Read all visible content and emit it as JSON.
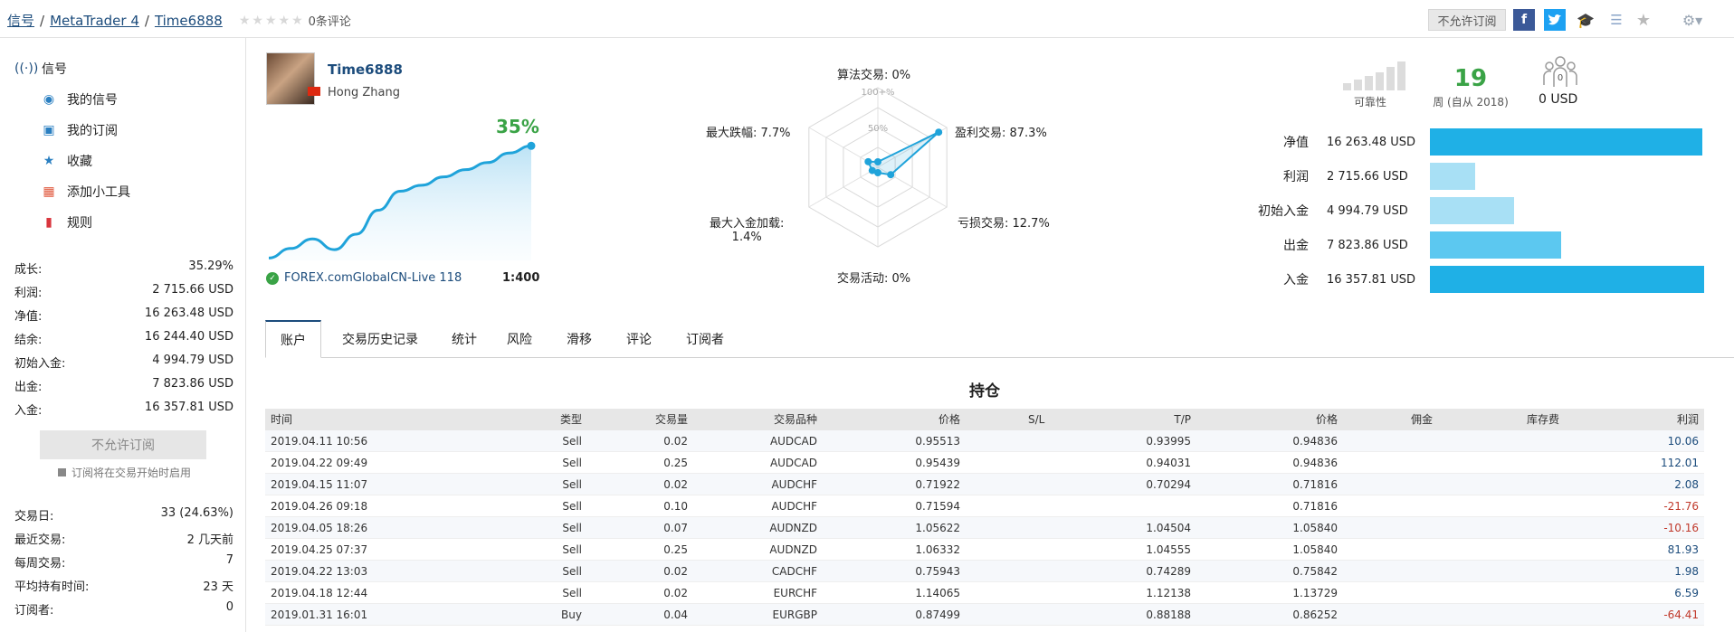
{
  "breadcrumb": {
    "root": "信号",
    "platform": "MetaTrader 4",
    "signal": "Time6888"
  },
  "rating": {
    "stars": 0,
    "reviews": "0条评论"
  },
  "top_actions": {
    "subscribe_disabled": "不允许订阅"
  },
  "sidebar": {
    "nav": [
      {
        "label": "信号",
        "icon": "antenna-icon"
      },
      {
        "label": "我的信号",
        "icon": "user-signal-icon"
      },
      {
        "label": "我的订阅",
        "icon": "subscription-icon"
      },
      {
        "label": "收藏",
        "icon": "star-icon"
      },
      {
        "label": "添加小工具",
        "icon": "widget-icon"
      },
      {
        "label": "规则",
        "icon": "bookmark-icon"
      }
    ],
    "stats": [
      {
        "label": "成长:",
        "value": "35.29%"
      },
      {
        "label": "利润:",
        "value": "2 715.66 USD"
      },
      {
        "label": "净值:",
        "value": "16 263.48 USD"
      },
      {
        "label": "结余:",
        "value": "16 244.40 USD"
      },
      {
        "label": "初始入金:",
        "value": "4 994.79 USD"
      },
      {
        "label": "出金:",
        "value": "7 823.86 USD"
      },
      {
        "label": "入金:",
        "value": "16 357.81 USD"
      }
    ],
    "subscribe_button": "不允许订阅",
    "subscribe_note": "订阅将在交易开始时启用",
    "stats2": [
      {
        "label": "交易日:",
        "value": "33 (24.63%)"
      },
      {
        "label": "最近交易:",
        "value": "2 几天前"
      },
      {
        "label": "每周交易:",
        "value": "7"
      },
      {
        "label": "平均持有时间:",
        "value": "23 天"
      },
      {
        "label": "订阅者:",
        "value": "0"
      }
    ]
  },
  "profile": {
    "name": "Time6888",
    "real_name": "Hong Zhang",
    "growth": "35%",
    "broker": "FOREX.comGlobalCN-Live 118",
    "leverage": "1:400"
  },
  "growth_curve": [
    2,
    10,
    18,
    9,
    22,
    42,
    58,
    63,
    70,
    76,
    82,
    90,
    96
  ],
  "radar": {
    "ring_labels": [
      "100+%",
      "50%"
    ],
    "axes": [
      {
        "label": "算法交易: 0%",
        "value": 0
      },
      {
        "label": "盈利交易: 87.3%",
        "value": 87.3
      },
      {
        "label": "亏损交易: 12.7%",
        "value": 12.7
      },
      {
        "label": "交易活动: 0%",
        "value": 0
      },
      {
        "label": "最大入金加载:",
        "label2": "1.4%",
        "value": 1.4
      },
      {
        "label": "最大跌幅: 7.7%",
        "value": 7.7
      }
    ]
  },
  "summary": {
    "reliability_label": "可靠性",
    "reliability_bars": 1,
    "weeks": "19",
    "weeks_label": "周 (自从 2018)",
    "subscribers": "0",
    "subscribers_usd": "0 USD",
    "balances": [
      {
        "label": "净值",
        "value": "16 263.48 USD",
        "amount": 16263.48,
        "color": "#1fb0e6"
      },
      {
        "label": "利润",
        "value": "2 715.66 USD",
        "amount": 2715.66,
        "color": "#a8e0f5"
      },
      {
        "label": "初始入金",
        "value": "4 994.79 USD",
        "amount": 4994.79,
        "color": "#a8e0f5"
      },
      {
        "label": "出金",
        "value": "7 823.86 USD",
        "amount": 7823.86,
        "color": "#5cc8f0"
      },
      {
        "label": "入金",
        "value": "16 357.81 USD",
        "amount": 16357.81,
        "color": "#1fb0e6"
      }
    ]
  },
  "tabs": [
    "账户",
    "交易历史记录",
    "统计",
    "风险",
    "滑移",
    "评论",
    "订阅者"
  ],
  "positions": {
    "title": "持仓",
    "headers": [
      "时间",
      "类型",
      "交易量",
      "交易品种",
      "价格",
      "S/L",
      "T/P",
      "价格",
      "佣金",
      "库存费",
      "利润"
    ],
    "rows": [
      [
        "2019.04.11 10:56",
        "Sell",
        "0.02",
        "AUDCAD",
        "0.95513",
        "",
        "0.93995",
        "0.94836",
        "",
        "",
        "10.06"
      ],
      [
        "2019.04.22 09:49",
        "Sell",
        "0.25",
        "AUDCAD",
        "0.95439",
        "",
        "0.94031",
        "0.94836",
        "",
        "",
        "112.01"
      ],
      [
        "2019.04.15 11:07",
        "Sell",
        "0.02",
        "AUDCHF",
        "0.71922",
        "",
        "0.70294",
        "0.71816",
        "",
        "",
        "2.08"
      ],
      [
        "2019.04.26 09:18",
        "Sell",
        "0.10",
        "AUDCHF",
        "0.71594",
        "",
        "",
        "0.71816",
        "",
        "",
        "-21.76"
      ],
      [
        "2019.04.05 18:26",
        "Sell",
        "0.07",
        "AUDNZD",
        "1.05622",
        "",
        "1.04504",
        "1.05840",
        "",
        "",
        "-10.16"
      ],
      [
        "2019.04.25 07:37",
        "Sell",
        "0.25",
        "AUDNZD",
        "1.06332",
        "",
        "1.04555",
        "1.05840",
        "",
        "",
        "81.93"
      ],
      [
        "2019.04.22 13:03",
        "Sell",
        "0.02",
        "CADCHF",
        "0.75943",
        "",
        "0.74289",
        "0.75842",
        "",
        "",
        "1.98"
      ],
      [
        "2019.04.18 12:44",
        "Sell",
        "0.02",
        "EURCHF",
        "1.14065",
        "",
        "1.12138",
        "1.13729",
        "",
        "",
        "6.59"
      ],
      [
        "2019.01.31 16:01",
        "Buy",
        "0.04",
        "EURGBP",
        "0.87499",
        "",
        "0.88188",
        "0.86252",
        "",
        "",
        "-64.41"
      ]
    ]
  }
}
